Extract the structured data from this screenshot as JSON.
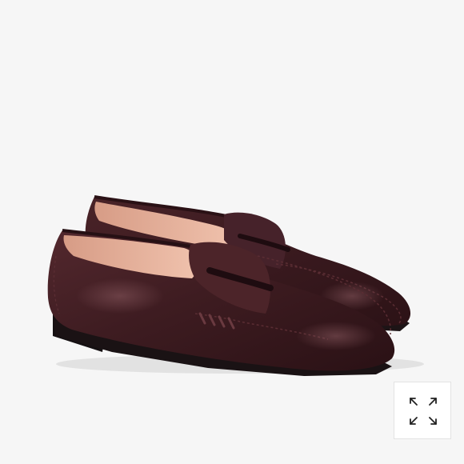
{
  "product": {
    "image_icon": "loafer-pair-image",
    "colors": {
      "background": "#f6f6f6",
      "leather": "#3b1c20",
      "lining": "#e8b39d",
      "sole": "#1c1416"
    }
  },
  "controls": {
    "expand_icon": "expand-arrows-icon"
  }
}
